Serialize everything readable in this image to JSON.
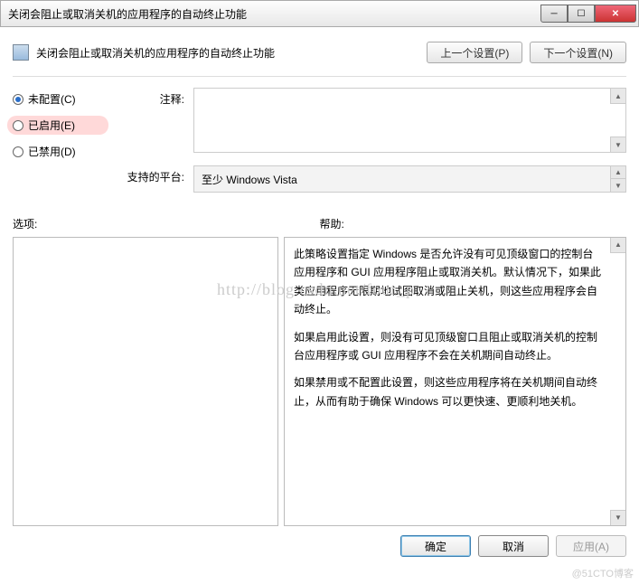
{
  "titlebar": {
    "text": "关闭会阻止或取消关机的应用程序的自动终止功能"
  },
  "header": {
    "title": "关闭会阻止或取消关机的应用程序的自动终止功能",
    "prev": "上一个设置(P)",
    "next": "下一个设置(N)"
  },
  "radios": {
    "not_configured": "未配置(C)",
    "enabled": "已启用(E)",
    "disabled": "已禁用(D)"
  },
  "fields": {
    "comment_label": "注释:",
    "platform_label": "支持的平台:",
    "platform_value": "至少 Windows Vista"
  },
  "labels": {
    "options": "选项:",
    "help": "帮助:"
  },
  "help": {
    "p1": "此策略设置指定 Windows 是否允许没有可见顶级窗口的控制台应用程序和 GUI 应用程序阻止或取消关机。默认情况下，如果此类应用程序无限期地试图取消或阻止关机，则这些应用程序会自动终止。",
    "p2": "如果启用此设置，则没有可见顶级窗口且阻止或取消关机的控制台应用程序或 GUI 应用程序不会在关机期间自动终止。",
    "p3": "如果禁用或不配置此设置，则这些应用程序将在关机期间自动终止，从而有助于确保 Windows 可以更快速、更顺利地关机。"
  },
  "footer": {
    "ok": "确定",
    "cancel": "取消",
    "apply": "应用(A)"
  },
  "watermark": "http://blog.csdn.net/four_p",
  "corner_wm": "@51CTO博客"
}
